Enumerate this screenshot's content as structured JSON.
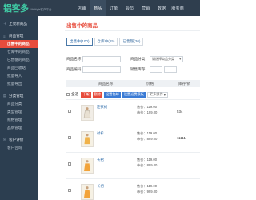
{
  "header": {
    "logo": "铝客多",
    "logo_sub": "Multiple客户平台",
    "nav": [
      "店铺",
      "商品",
      "订单",
      "会员",
      "营销",
      "数据",
      "服务商"
    ],
    "active_nav": 1
  },
  "sidebar": {
    "items": [
      {
        "label": "上架新商品",
        "kind": "group",
        "icon": "plus-icon"
      },
      {
        "label": "商品管理",
        "kind": "group",
        "icon": "list-icon"
      },
      {
        "label": "出售中的商品",
        "kind": "sub",
        "active": true
      },
      {
        "label": "仓库中的商品",
        "kind": "sub"
      },
      {
        "label": "已售罄的商品",
        "kind": "sub"
      },
      {
        "label": "商品回收站",
        "kind": "sub"
      },
      {
        "label": "批量导入",
        "kind": "sub"
      },
      {
        "label": "批量导出",
        "kind": "sub"
      },
      {
        "label": "分类管理",
        "kind": "group",
        "icon": "folder-icon"
      },
      {
        "label": "商品分类",
        "kind": "sub"
      },
      {
        "label": "类型管理",
        "kind": "sub"
      },
      {
        "label": "规格管理",
        "kind": "sub"
      },
      {
        "label": "品牌管理",
        "kind": "sub"
      },
      {
        "label": "客户评价",
        "kind": "group",
        "icon": "comment-icon"
      },
      {
        "label": "客户咨询",
        "kind": "sub"
      }
    ]
  },
  "main": {
    "title": "出售中的商品",
    "tabs": [
      {
        "label": "出售中(100)",
        "active": true
      },
      {
        "label": "仓库中(25)",
        "active": false
      },
      {
        "label": "已售罄(30)",
        "active": false
      }
    ],
    "filters": {
      "name_label": "商品名称：",
      "code_label": "商品编码：",
      "category_label": "商品分类：",
      "category_value": "请选择商品分类",
      "stock_label": "销售库存："
    },
    "table": {
      "columns": [
        "商品名称",
        "价格",
        "库存/销"
      ],
      "select_all": "全选",
      "actions": [
        "下架",
        "删除",
        "设置包邮",
        "设置运费模板",
        "更多操作"
      ]
    },
    "rows": [
      {
        "name": "连衣裙",
        "price": "售价：119.00",
        "market": "市价：199.00",
        "stock": "534",
        "thumb": "thumb-dress-1"
      },
      {
        "name": "衬衫",
        "price": "售价：119.00",
        "market": "市价：899.00",
        "stock": "11111",
        "thumb": "thumb-dress-2"
      },
      {
        "name": "长裙",
        "price": "售价：119.00",
        "market": "市价：899.00",
        "stock": "",
        "thumb": "thumb-dress-3"
      },
      {
        "name": "长裙",
        "price": "售价：119.00",
        "market": "市价：999.00",
        "stock": "",
        "thumb": "thumb-dress-4"
      }
    ]
  },
  "colors": {
    "sidebar": "#2c3e50",
    "header": "#2f3e4e",
    "accent": "#e74c3c",
    "link": "#2c6aa8"
  }
}
